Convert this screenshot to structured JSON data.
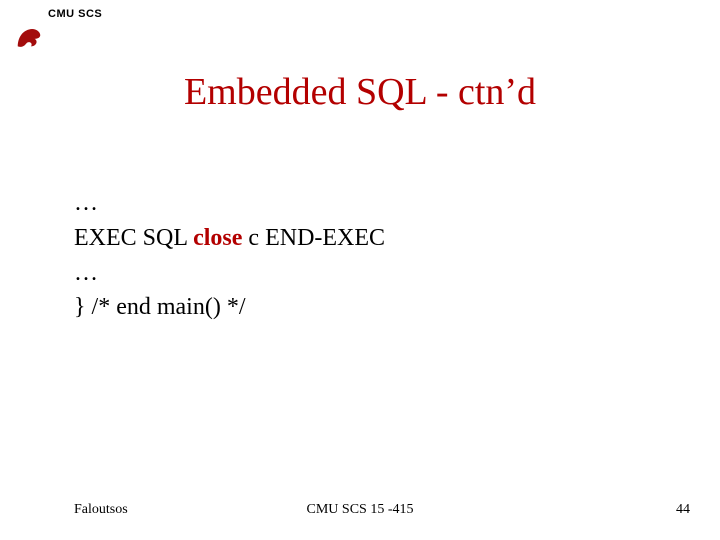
{
  "header": {
    "label": "CMU SCS"
  },
  "title": "Embedded SQL - ctn’d",
  "body": {
    "line1": "…",
    "line2_pre": "EXEC SQL   ",
    "line2_kw": "close",
    "line2_post": " c END-EXEC",
    "line3": "…",
    "line4": "} /* end main() */"
  },
  "footer": {
    "left": "Faloutsos",
    "center": "CMU SCS 15 -415",
    "right": "44"
  }
}
